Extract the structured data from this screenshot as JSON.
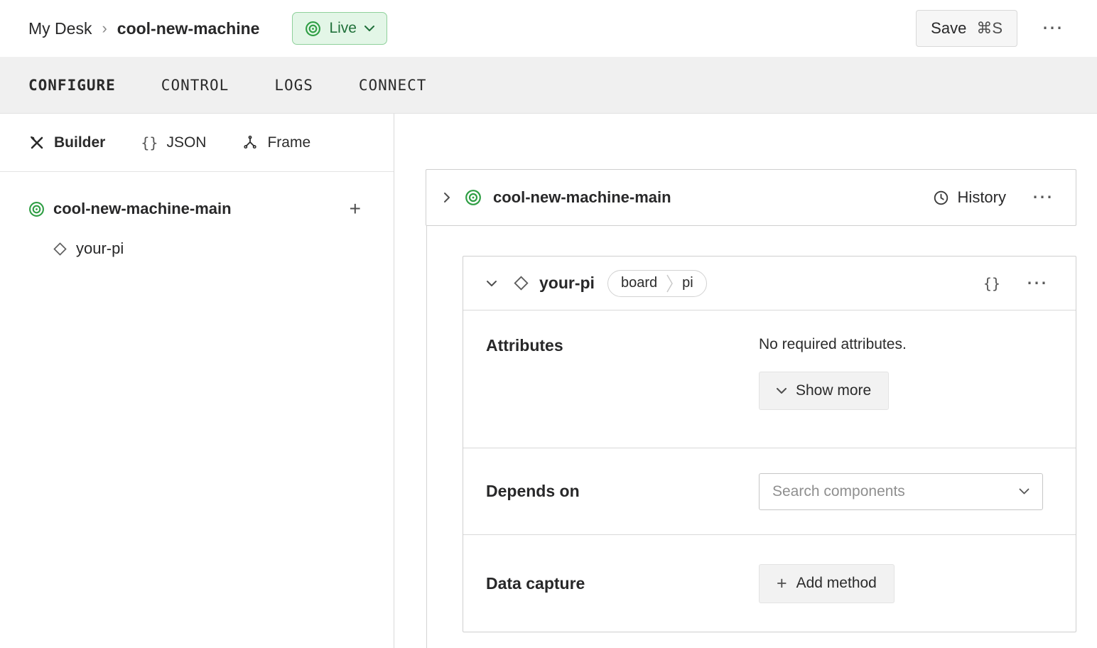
{
  "header": {
    "breadcrumb": {
      "root": "My Desk",
      "separator": "›",
      "current": "cool-new-machine"
    },
    "live": {
      "label": "Live"
    },
    "save": {
      "label": "Save",
      "shortcut": "⌘S"
    }
  },
  "tabs": [
    {
      "label": "CONFIGURE",
      "active": true
    },
    {
      "label": "CONTROL",
      "active": false
    },
    {
      "label": "LOGS",
      "active": false
    },
    {
      "label": "CONNECT",
      "active": false
    }
  ],
  "sidebar": {
    "modes": [
      {
        "label": "Builder",
        "active": true
      },
      {
        "label": "JSON",
        "active": false
      },
      {
        "label": "Frame",
        "active": false
      }
    ],
    "tree": {
      "root_label": "cool-new-machine-main",
      "child_label": "your-pi"
    }
  },
  "main": {
    "machine_card": {
      "title": "cool-new-machine-main",
      "history": "History"
    },
    "component_card": {
      "title": "your-pi",
      "badge": {
        "type": "board",
        "model": "pi"
      },
      "attributes": {
        "label": "Attributes",
        "empty": "No required attributes.",
        "show_more": "Show more"
      },
      "depends_on": {
        "label": "Depends on",
        "placeholder": "Search components"
      },
      "data_capture": {
        "label": "Data capture",
        "add_method": "Add method"
      }
    }
  },
  "icons": {
    "more": "⋯",
    "braces": "{}",
    "plus": "+"
  },
  "colors": {
    "accent_green": "#2f9e44",
    "live_bg": "#e3f6e7",
    "live_border": "#8fd19b",
    "live_text": "#20703a"
  }
}
